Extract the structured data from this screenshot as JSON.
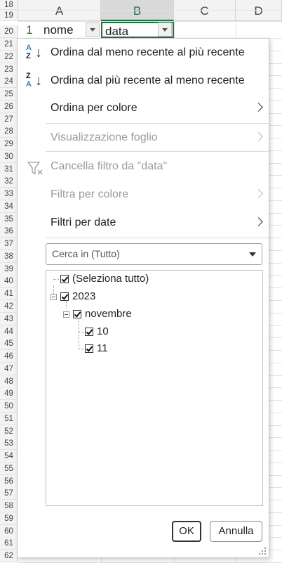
{
  "columns": [
    "A",
    "B",
    "C",
    "D"
  ],
  "selected_column": "B",
  "rows": [
    "18",
    "19",
    "20",
    "21",
    "22",
    "23",
    "24",
    "25",
    "26",
    "27",
    "28",
    "29",
    "30",
    "31",
    "32",
    "33",
    "34",
    "35",
    "36",
    "37",
    "38",
    "39",
    "40",
    "41",
    "42",
    "43",
    "44",
    "45",
    "46",
    "47",
    "48",
    "49",
    "50",
    "51",
    "52",
    "53",
    "54",
    "55",
    "56",
    "57",
    "58",
    "59",
    "60",
    "61",
    "62"
  ],
  "header_row": {
    "number": "1",
    "a1": "nome",
    "b1": "data"
  },
  "menu": {
    "sort_asc": {
      "label": "Ordina dal meno recente al più recente",
      "icon_top": "A",
      "icon_bottom": "Z"
    },
    "sort_desc": {
      "label": "Ordina dal più recente al meno recente",
      "icon_top": "Z",
      "icon_bottom": "A"
    },
    "sort_by_color": "Ordina per colore",
    "sheet_view": "Visualizzazione foglio",
    "clear_filter": "Cancella filtro da \"data\"",
    "filter_by_color": "Filtra per colore",
    "date_filters": "Filtri per date"
  },
  "search": {
    "placeholder": "Cerca in (Tutto)"
  },
  "tree": {
    "select_all": "(Seleziona tutto)",
    "year": "2023",
    "month": "novembre",
    "days": [
      "10",
      "11"
    ]
  },
  "buttons": {
    "ok": "OK",
    "cancel": "Annulla"
  },
  "colors": {
    "accent_green": "#217346",
    "sort_blue": "#2c7cd4",
    "disabled": "#9c9c9c"
  },
  "icons": [
    "sort-ascending-icon",
    "sort-descending-icon",
    "clear-filter-icon",
    "chevron-right-icon",
    "dropdown-caret-icon",
    "checkbox-icon",
    "collapse-icon",
    "resize-grip-icon"
  ]
}
